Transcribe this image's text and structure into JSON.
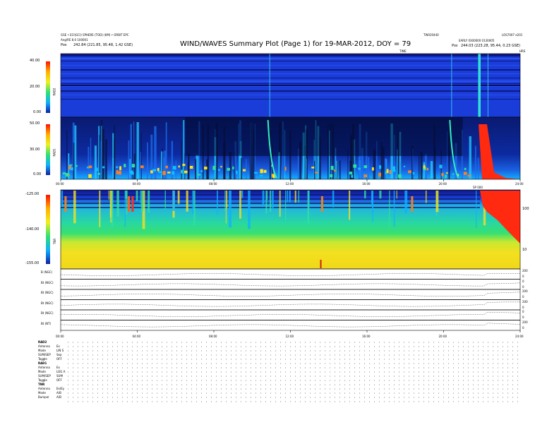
{
  "header": {
    "title": "WIND/WAVES Summary Plot (Page 1) for 19-MAR-2012, DOY = 79",
    "tl_line1": "GSE • ECI(GCI) SPHERE (TOD) (KM) • ORBIT EPC",
    "tl_line2": "Ang/RE 8.0 100001",
    "tl_pos_label": "Pos",
    "tl_pos_value": "242.84 (221.85, 95.48, 1.42 GSE)",
    "tr_left": "TW020440",
    "tr_right": "LOS7007 e201",
    "tr_line2": "EARLY 0300000 0130005",
    "tr_pos_label": "Pos",
    "tr_pos_value": "244.03 (223.28, 95.44, 0.23 GSE)",
    "time_label": "TIME",
    "hrs_label": "HRS"
  },
  "panels": {
    "rad2": {
      "label": "RAD2",
      "ticks": [
        "40.00",
        "20.00",
        "0.00"
      ]
    },
    "rad1": {
      "label": "RAD1",
      "ticks": [
        "50.00",
        "30.00",
        "0.00"
      ]
    },
    "tnr": {
      "label": "TNR",
      "ticks": [
        "-125.00",
        "-140.00",
        "-155.00"
      ],
      "right_ticks": [
        "100",
        "10"
      ],
      "top_label": "SP 000"
    }
  },
  "time_axis": [
    "00:00",
    "04:00",
    "08:00",
    "12:00",
    "16:00",
    "20:00",
    "24:00"
  ],
  "mag_labels": [
    "B (NGC)",
    "Bt (NGC)",
    "Bt (NGC)",
    "Bt (NGC)",
    "Bt (NGC)",
    "Bt (NT)"
  ],
  "mag_right_ticks": [
    [
      "200",
      "0"
    ],
    [
      "0",
      "0"
    ],
    [
      "200",
      "0"
    ],
    [
      "200",
      "0"
    ],
    [
      "0",
      "0"
    ],
    [
      "200",
      "0"
    ]
  ],
  "status": {
    "rad2_head": "RAD2",
    "rad2_rows": [
      {
        "k": "Antenna",
        "v": "Ex"
      },
      {
        "k": "Mode",
        "v": "LIN S"
      },
      {
        "k": "SUM/SEP",
        "v": "Sep"
      },
      {
        "k": "Toggle",
        "v": "OFF"
      }
    ],
    "rad1_head": "RAD1",
    "rad1_rows": [
      {
        "k": "Antenna",
        "v": "Ex"
      },
      {
        "k": "Mode",
        "v": "LOG A"
      },
      {
        "k": "SUM/SEP",
        "v": "SUM"
      },
      {
        "k": "Toggle",
        "v": "OFF"
      }
    ],
    "tnr_head": "TNR",
    "tnr_rows": [
      {
        "k": "Antenna",
        "v": "Ex/Ey"
      },
      {
        "k": "Mode",
        "v": "A/B"
      },
      {
        "k": "Bumper",
        "v": "A/B"
      }
    ]
  },
  "chart_data": {
    "type": "heatmap",
    "title": "WIND/WAVES Summary Plot (Page 1) for 19-MAR-2012, DOY = 79",
    "x_range_hours": [
      0,
      24
    ],
    "x_ticks": [
      "00:00",
      "04:00",
      "08:00",
      "12:00",
      "16:00",
      "20:00",
      "24:00"
    ],
    "panels": [
      {
        "name": "RAD2",
        "y_ticks": [
          40,
          20,
          0
        ],
        "ylim": [
          0,
          40
        ]
      },
      {
        "name": "RAD1",
        "y_ticks": [
          50,
          30,
          0
        ],
        "ylim": [
          0,
          60
        ]
      },
      {
        "name": "TNR",
        "y_ticks": [
          -125,
          -140,
          -155
        ],
        "ylim": [
          -155,
          -125
        ],
        "right_ticks": [
          100,
          10
        ]
      }
    ],
    "events_hours": [
      10.9,
      20.4,
      21.8,
      22.3
    ]
  },
  "colors": {
    "bg_blue": "#1a3cd8",
    "dark": "#000a30",
    "burst": "#ff2a10",
    "tnr_mid": "#30e070",
    "tnr_low": "#f4e020"
  }
}
